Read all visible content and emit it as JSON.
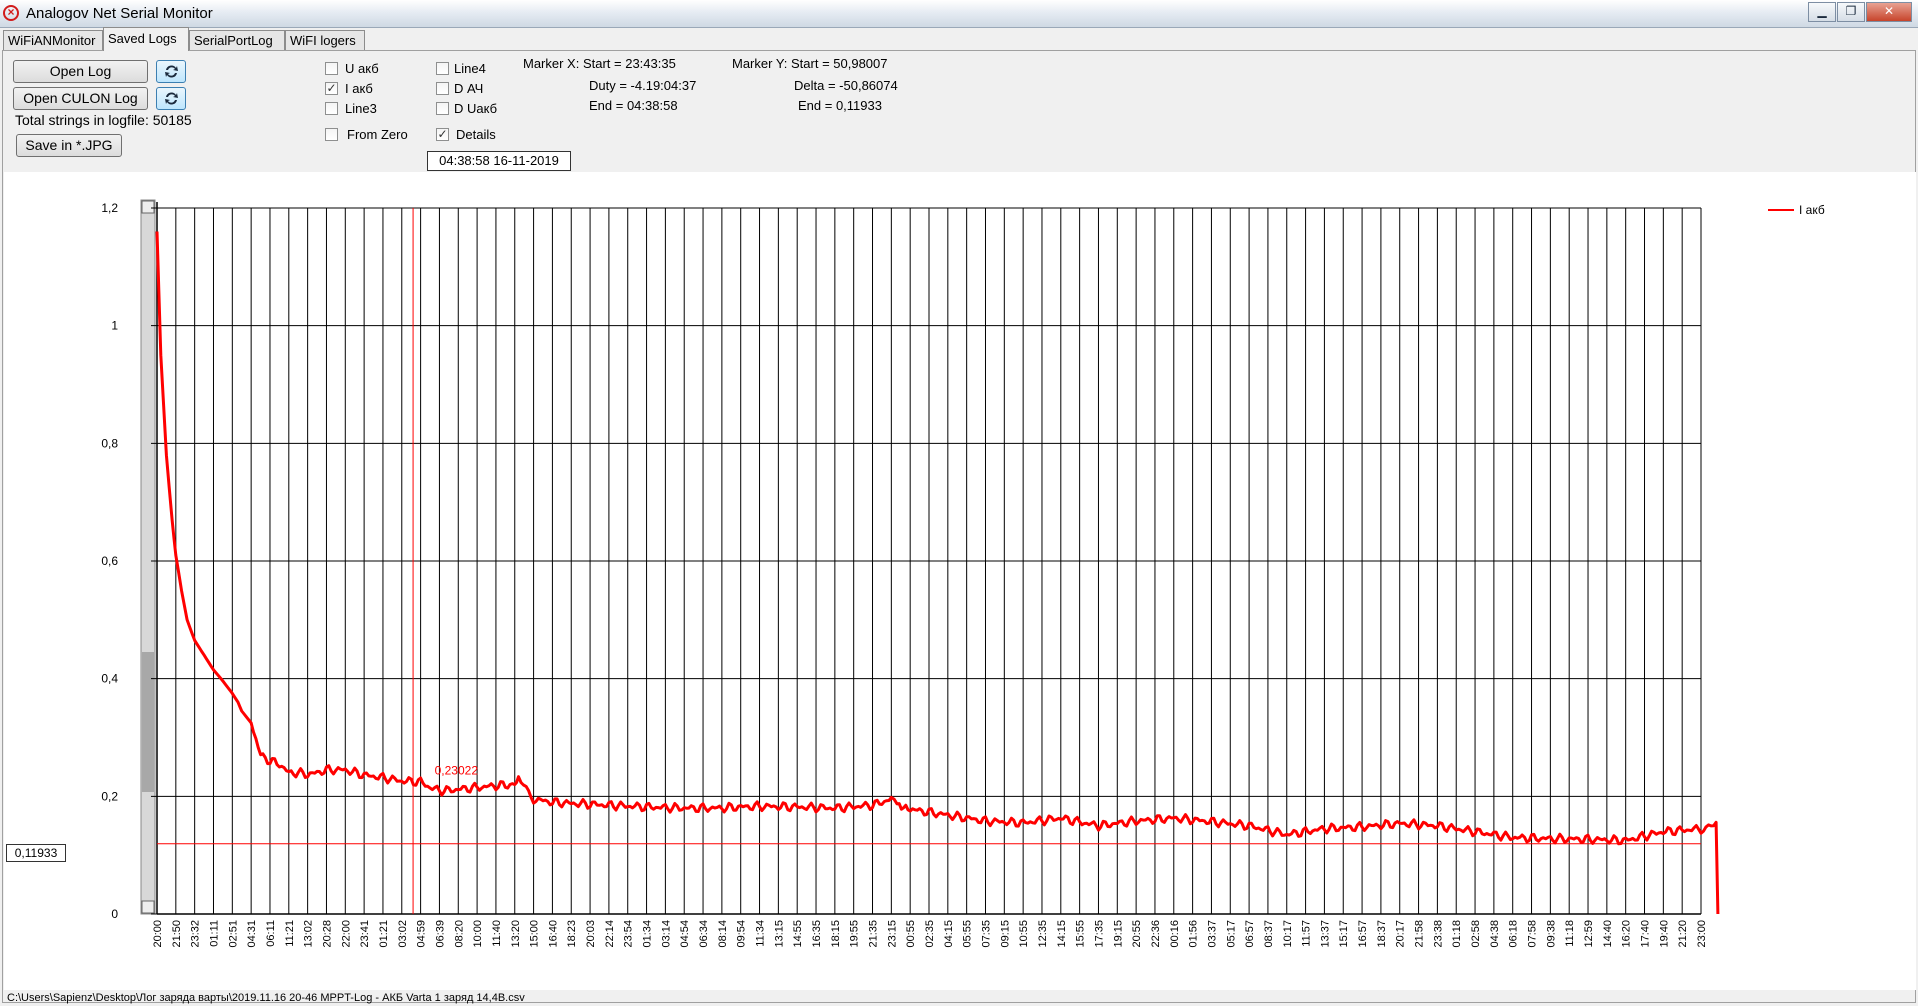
{
  "window": {
    "title": "Analogov Net Serial Monitor"
  },
  "tabs": [
    {
      "label": "WiFiANMonitor"
    },
    {
      "label": "Saved Logs",
      "active": true
    },
    {
      "label": "SerialPortLog"
    },
    {
      "label": "WiFI logers"
    }
  ],
  "toolbar": {
    "open_log": "Open Log",
    "open_culon_log": "Open CULON Log",
    "save_jpg": "Save in *.JPG",
    "total_strings": "Total strings in logfile: 50185",
    "refresh_icon": "refresh-icon"
  },
  "checkboxes": [
    {
      "label": "U акб",
      "checked": false
    },
    {
      "label": "I акб",
      "checked": true
    },
    {
      "label": "Line3",
      "checked": false
    },
    {
      "label": "From Zero",
      "checked": false
    },
    {
      "label": "Line4",
      "checked": false
    },
    {
      "label": "D АЧ",
      "checked": false
    },
    {
      "label": "D Uакб",
      "checked": false
    },
    {
      "label": "Details",
      "checked": true
    }
  ],
  "markers": {
    "x_start": "Marker X: Start = 23:43:35",
    "x_duty": "Duty = -4.19:04:37",
    "x_end": "End  = 04:38:58",
    "y_start": "Marker Y: Start = 50,98007",
    "y_delta": "Delta = -50,86074",
    "y_end": "End  = 0,11933"
  },
  "cursor_datetime": "04:38:58 16-11-2019",
  "marker_value_box": "0,11933",
  "status_path": "C:\\Users\\Sapienz\\Desktop\\Лог заряда варты\\2019.11.16 20-46 MPPT-Log -  АКБ Varta 1 заряд 14,4В.csv",
  "colors": {
    "series": "#ff0000",
    "grid": "#000000"
  },
  "chart_data": {
    "type": "line",
    "ylim": [
      0,
      1.2
    ],
    "y_ticks": [
      "0",
      "0,2",
      "0,4",
      "0,6",
      "0,8",
      "1",
      "1,2"
    ],
    "x_ticks": [
      "20:00",
      "21:50",
      "23:32",
      "01:11",
      "02:51",
      "04:31",
      "06:11",
      "11:21",
      "13:02",
      "20:28",
      "22:00",
      "23:41",
      "01:21",
      "03:02",
      "04:59",
      "06:39",
      "08:20",
      "10:00",
      "11:40",
      "13:20",
      "15:00",
      "16:40",
      "18:23",
      "20:03",
      "22:14",
      "23:54",
      "01:34",
      "03:14",
      "04:54",
      "06:34",
      "08:14",
      "09:54",
      "11:34",
      "13:15",
      "14:55",
      "16:35",
      "18:15",
      "19:55",
      "21:35",
      "23:15",
      "00:55",
      "02:35",
      "04:15",
      "05:55",
      "07:35",
      "09:15",
      "10:55",
      "12:35",
      "14:15",
      "15:55",
      "17:35",
      "19:15",
      "20:55",
      "22:36",
      "00:16",
      "01:56",
      "03:37",
      "05:17",
      "06:57",
      "08:37",
      "10:17",
      "11:57",
      "13:37",
      "15:17",
      "16:57",
      "18:37",
      "20:17",
      "21:58",
      "23:38",
      "01:18",
      "02:58",
      "04:38",
      "06:18",
      "07:58",
      "09:38",
      "11:18",
      "12:59",
      "14:40",
      "16:20",
      "17:40",
      "19:40",
      "21:20",
      "23:00"
    ],
    "series": [
      {
        "name": "I акб",
        "x": [
          0,
          0.2,
          0.5,
          0.8,
          1,
          1.3,
          1.6,
          2,
          2.5,
          3,
          3.4,
          4,
          4.3,
          4.5,
          5,
          5.5,
          6,
          6.5,
          7,
          7.5,
          8,
          8.5,
          9,
          10,
          11,
          12,
          13,
          14,
          14.5,
          15,
          15.5,
          16,
          17,
          18,
          19,
          19.2,
          20,
          21,
          22,
          24,
          26,
          28,
          30,
          31,
          32,
          34,
          36,
          38,
          39,
          39.3,
          40,
          42,
          44,
          46,
          48,
          50,
          52,
          54,
          56,
          58,
          60,
          62,
          64,
          66,
          68,
          70,
          72,
          74,
          76,
          78,
          80,
          82,
          82.8,
          82.9
        ],
        "y": [
          1.16,
          0.95,
          0.78,
          0.67,
          0.61,
          0.55,
          0.5,
          0.465,
          0.44,
          0.415,
          0.4,
          0.375,
          0.36,
          0.345,
          0.325,
          0.27,
          0.26,
          0.255,
          0.24,
          0.24,
          0.237,
          0.24,
          0.245,
          0.245,
          0.236,
          0.232,
          0.226,
          0.225,
          0.215,
          0.21,
          0.21,
          0.212,
          0.215,
          0.218,
          0.22,
          0.23,
          0.195,
          0.19,
          0.188,
          0.185,
          0.182,
          0.18,
          0.18,
          0.182,
          0.183,
          0.182,
          0.18,
          0.185,
          0.195,
          0.185,
          0.178,
          0.168,
          0.158,
          0.155,
          0.163,
          0.15,
          0.158,
          0.163,
          0.157,
          0.15,
          0.135,
          0.145,
          0.148,
          0.154,
          0.15,
          0.14,
          0.13,
          0.128,
          0.127,
          0.125,
          0.14,
          0.145,
          0.155,
          0.0
        ]
      }
    ],
    "markers": [
      {
        "axis": "y",
        "value": 0.11933
      },
      {
        "axis": "x",
        "category_index": 13.6
      }
    ],
    "annotations": [
      {
        "text": "0,23022",
        "x": 14,
        "y": 0.23022
      }
    ],
    "legend_position": "top-right",
    "grid": true
  }
}
